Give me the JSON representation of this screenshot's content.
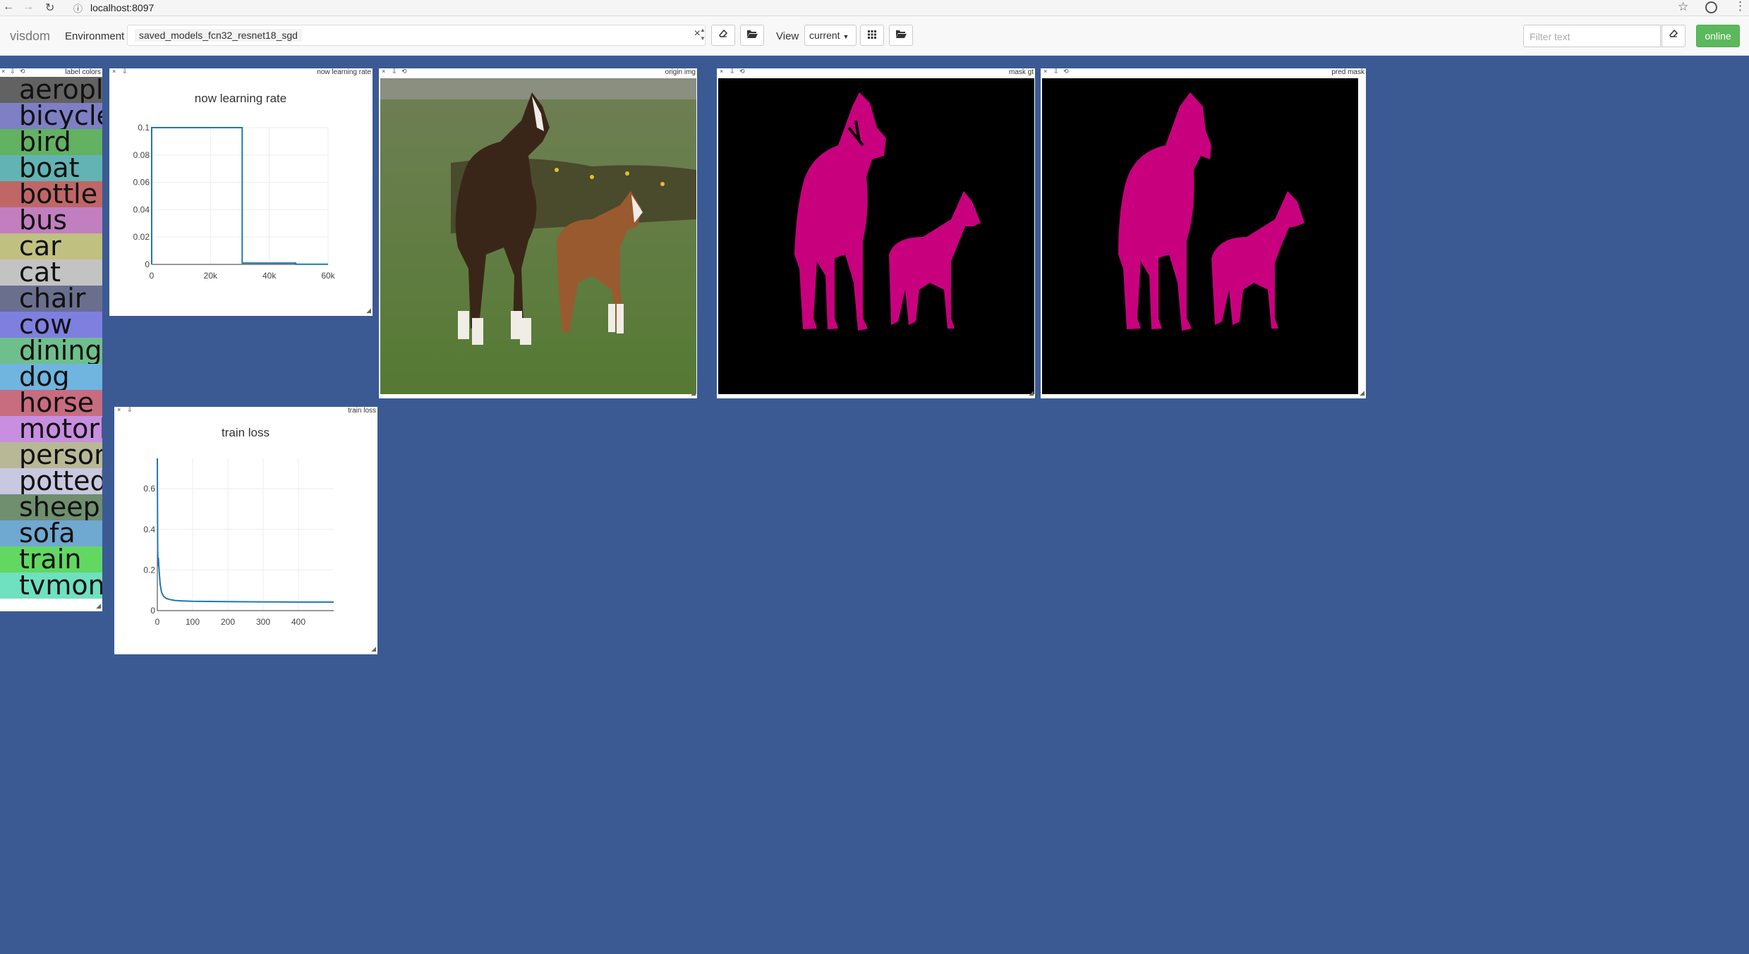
{
  "browser": {
    "url": "localhost:8097"
  },
  "toolbar": {
    "brand": "visdom",
    "environment_label": "Environment",
    "environment_value": "saved_models_fcn32_resnet18_sgd",
    "view_label": "View",
    "view_value": "current",
    "filter_placeholder": "Filter text",
    "status_button": "online"
  },
  "panes": {
    "label_colors": {
      "title": "label colors",
      "items": [
        {
          "label": "aeroplane",
          "color": "#626262"
        },
        {
          "label": "bicycle",
          "color": "#7f7fc5"
        },
        {
          "label": "bird",
          "color": "#62b262"
        },
        {
          "label": "boat",
          "color": "#62b4b4"
        },
        {
          "label": "bottle",
          "color": "#c06666"
        },
        {
          "label": "bus",
          "color": "#c17fc0"
        },
        {
          "label": "car",
          "color": "#c0c081"
        },
        {
          "label": "cat",
          "color": "#c3c3c3"
        },
        {
          "label": "chair",
          "color": "#6b6f8e"
        },
        {
          "label": "cow",
          "color": "#7f7fe0"
        },
        {
          "label": "diningtable",
          "color": "#6fbf8c"
        },
        {
          "label": "dog",
          "color": "#6fb5e0"
        },
        {
          "label": "horse",
          "color": "#c86c80"
        },
        {
          "label": "motorbike",
          "color": "#c88ee0"
        },
        {
          "label": "person",
          "color": "#b8b896"
        },
        {
          "label": "pottedplant",
          "color": "#c8c8e0"
        },
        {
          "label": "sheep",
          "color": "#6f8f6f"
        },
        {
          "label": "sofa",
          "color": "#6fa8d0"
        },
        {
          "label": "train",
          "color": "#62d862"
        },
        {
          "label": "tvmonitor",
          "color": "#6fe0c0"
        }
      ]
    },
    "lr_chart": {
      "title": "now learning rate",
      "chart_data": {
        "type": "line",
        "title": "now learning rate",
        "xlabel": "",
        "ylabel": "",
        "xlim": [
          0,
          60000
        ],
        "ylim": [
          0,
          0.1
        ],
        "x_ticks": [
          "0",
          "20k",
          "40k",
          "60k"
        ],
        "y_ticks": [
          "0",
          "0.02",
          "0.04",
          "0.06",
          "0.08",
          "0.1"
        ],
        "grid": true,
        "series": [
          {
            "x": [
              0,
              0,
              30800,
              30800,
              49000,
              49000,
              60000
            ],
            "y": [
              0,
              0.1,
              0.1,
              0.001,
              0.001,
              0.0001,
              0.0001
            ]
          }
        ]
      }
    },
    "origin_img": {
      "title": "origin img"
    },
    "mask_gt": {
      "title": "mask gt"
    },
    "pred_mask": {
      "title": "pred mask"
    },
    "train_loss": {
      "title": "train loss",
      "chart_data": {
        "type": "line",
        "title": "train loss",
        "xlabel": "",
        "ylabel": "",
        "xlim": [
          0,
          500
        ],
        "ylim": [
          0,
          0.75
        ],
        "x_ticks": [
          "0",
          "100",
          "200",
          "300",
          "400"
        ],
        "y_ticks": [
          "0",
          "0.2",
          "0.4",
          "0.6"
        ],
        "grid": true,
        "series": [
          {
            "x": [
              0,
              1,
              2,
              3,
              5,
              8,
              12,
              18,
              25,
              35,
              50,
              70,
              100,
              150,
              200,
              300,
              400,
              500
            ],
            "y": [
              0.75,
              0.3,
              0.22,
              0.26,
              0.2,
              0.13,
              0.09,
              0.07,
              0.06,
              0.055,
              0.05,
              0.048,
              0.046,
              0.045,
              0.044,
              0.043,
              0.042,
              0.042
            ]
          }
        ]
      }
    }
  },
  "colors": {
    "background": "#3b5a93",
    "mask": "#c8007e",
    "line": "#1f77b4",
    "online": "#5cb85c"
  }
}
